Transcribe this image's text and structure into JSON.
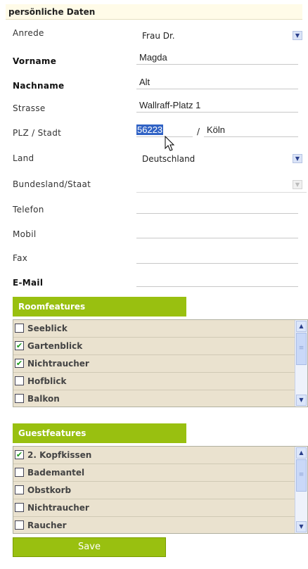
{
  "section_title": "persönliche Daten",
  "fields": {
    "anrede": {
      "label": "Anrede",
      "value": "Frau Dr."
    },
    "vorname": {
      "label": "Vorname",
      "value": "Magda"
    },
    "nachname": {
      "label": "Nachname",
      "value": "Alt"
    },
    "strasse": {
      "label": "Strasse",
      "value": "Wallraff-Platz 1"
    },
    "plz_stadt": {
      "label": "PLZ / Stadt",
      "plz": "56223",
      "separator": "/",
      "stadt": "Köln"
    },
    "land": {
      "label": "Land",
      "value": "Deutschland"
    },
    "bundesland": {
      "label": "Bundesland/Staat",
      "value": ""
    },
    "telefon": {
      "label": "Telefon",
      "value": ""
    },
    "mobil": {
      "label": "Mobil",
      "value": ""
    },
    "fax": {
      "label": "Fax",
      "value": ""
    },
    "email": {
      "label": "E-Mail",
      "value": ""
    }
  },
  "roomfeatures": {
    "title": "Roomfeatures",
    "items": [
      {
        "label": "Seeblick",
        "checked": false
      },
      {
        "label": "Gartenblick",
        "checked": true
      },
      {
        "label": "Nichtraucher",
        "checked": true
      },
      {
        "label": "Hofblick",
        "checked": false
      },
      {
        "label": "Balkon",
        "checked": false
      }
    ]
  },
  "guestfeatures": {
    "title": "Guestfeatures",
    "items": [
      {
        "label": "2. Kopfkissen",
        "checked": true
      },
      {
        "label": "Bademantel",
        "checked": false
      },
      {
        "label": "Obstkorb",
        "checked": false
      },
      {
        "label": "Nichtraucher",
        "checked": false
      },
      {
        "label": "Raucher",
        "checked": false
      }
    ]
  },
  "save_label": "Save",
  "icons": {
    "dropdown": "chevron-down-icon",
    "checkmark": "checkmark-icon",
    "cursor": "mouse-pointer-icon"
  },
  "colors": {
    "accent": "#99c010",
    "list_bg": "#eae2cf",
    "selection": "#3163c5"
  }
}
